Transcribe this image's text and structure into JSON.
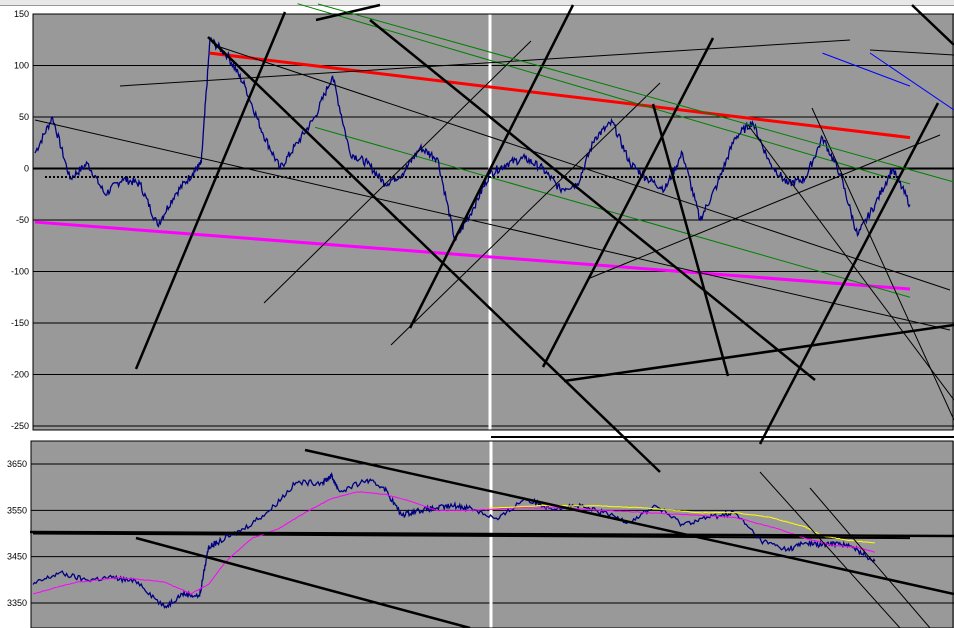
{
  "colors": {
    "plot_bg": "#999999",
    "grid": "#000000",
    "price": "#000080",
    "red": "#ff0000",
    "magenta": "#ff00ff",
    "green": "#008000",
    "blue": "#0000ff",
    "yellow": "#ffff00",
    "drawn": "#000000"
  },
  "chart_data": [
    {
      "type": "line",
      "title": "",
      "xlabel": "",
      "ylabel": "",
      "ylim": [
        -250,
        150
      ],
      "yticks": [
        150,
        100,
        50,
        0,
        -50,
        -100,
        -150,
        -200,
        -250
      ],
      "ytick_labels": [
        "150",
        "100",
        "50",
        "0",
        "-50",
        "-100",
        "-150",
        "-200",
        "-250"
      ],
      "grid": true,
      "x_unit": "bar index (0-100 across panel)",
      "series": [
        {
          "color": "#000080",
          "x": [
            0,
            2,
            4,
            6,
            8,
            10,
            12,
            14,
            16,
            18,
            19,
            20,
            22,
            24,
            26,
            28,
            30,
            32,
            34,
            36,
            38,
            40,
            42,
            44,
            46,
            48,
            50,
            52,
            54,
            56,
            58,
            60,
            62,
            64,
            66,
            68,
            70,
            72,
            74,
            76,
            78,
            80,
            82,
            84,
            86,
            88,
            90,
            92,
            94,
            96,
            98,
            100
          ],
          "y": [
            15,
            50,
            -10,
            5,
            -25,
            -10,
            -15,
            -55,
            -25,
            -5,
            5,
            125,
            110,
            80,
            35,
            0,
            25,
            50,
            90,
            15,
            5,
            -15,
            -5,
            20,
            10,
            -70,
            -40,
            -5,
            5,
            10,
            0,
            -20,
            -15,
            30,
            45,
            5,
            -10,
            -20,
            15,
            -50,
            -15,
            30,
            45,
            5,
            -15,
            -10,
            30,
            -5,
            -65,
            -35,
            0,
            -35
          ]
        }
      ],
      "reference_lines": [
        {
          "color": "#ff0000",
          "from": [
            20,
            112
          ],
          "to": [
            100,
            30
          ]
        },
        {
          "color": "#ff00ff",
          "from": [
            0,
            -52
          ],
          "to": [
            100,
            -117
          ]
        },
        {
          "color": "#008000",
          "from": [
            32,
            40
          ],
          "to": [
            100,
            -125
          ]
        },
        {
          "color": "#008000",
          "from": [
            30,
            160
          ],
          "to": [
            100,
            -15
          ]
        },
        {
          "color": "#0000ff",
          "from": [
            90,
            112
          ],
          "to": [
            100,
            80
          ]
        }
      ]
    },
    {
      "type": "line",
      "title": "",
      "xlabel": "",
      "ylabel": "",
      "ylim": [
        3300,
        3700
      ],
      "yticks": [
        3650,
        3550,
        3450,
        3350
      ],
      "ytick_labels": [
        "3650",
        "3550",
        "3450",
        "3350"
      ],
      "grid": true,
      "x_unit": "bar index (0-100 across panel)",
      "series": [
        {
          "color": "#000080",
          "x": [
            0,
            3,
            6,
            9,
            12,
            15,
            17,
            19,
            20,
            21,
            24,
            27,
            30,
            33,
            34,
            35,
            38,
            40,
            42,
            44,
            46,
            48,
            50,
            53,
            56,
            59,
            62,
            65,
            68,
            71,
            74,
            77,
            80,
            83,
            86,
            88,
            90,
            92,
            94,
            96
          ],
          "y": [
            3390,
            3415,
            3400,
            3405,
            3395,
            3340,
            3370,
            3365,
            3470,
            3480,
            3510,
            3550,
            3610,
            3610,
            3625,
            3590,
            3615,
            3600,
            3540,
            3550,
            3555,
            3560,
            3555,
            3530,
            3575,
            3555,
            3560,
            3545,
            3525,
            3560,
            3520,
            3535,
            3545,
            3485,
            3465,
            3480,
            3475,
            3480,
            3465,
            3440
          ]
        },
        {
          "color": "#ff00ff",
          "x": [
            0,
            5,
            10,
            15,
            18,
            20,
            22,
            25,
            28,
            31,
            34,
            37,
            40,
            43,
            46,
            50,
            55,
            60,
            65,
            70,
            75,
            80,
            85,
            88,
            91,
            94,
            96
          ],
          "y": [
            3370,
            3395,
            3405,
            3395,
            3370,
            3390,
            3440,
            3490,
            3510,
            3545,
            3575,
            3590,
            3585,
            3570,
            3550,
            3550,
            3555,
            3555,
            3550,
            3545,
            3540,
            3535,
            3510,
            3490,
            3475,
            3470,
            3460
          ]
        },
        {
          "color": "#ffff00",
          "x": [
            52,
            58,
            64,
            70,
            76,
            80,
            84,
            86,
            88,
            90,
            93,
            96
          ],
          "y": [
            3555,
            3560,
            3560,
            3555,
            3545,
            3545,
            3535,
            3525,
            3515,
            3495,
            3485,
            3480
          ]
        }
      ],
      "reference_lines": [
        {
          "color": "#000000",
          "from": [
            0,
            3500
          ],
          "to": [
            100,
            3490
          ]
        }
      ]
    }
  ]
}
